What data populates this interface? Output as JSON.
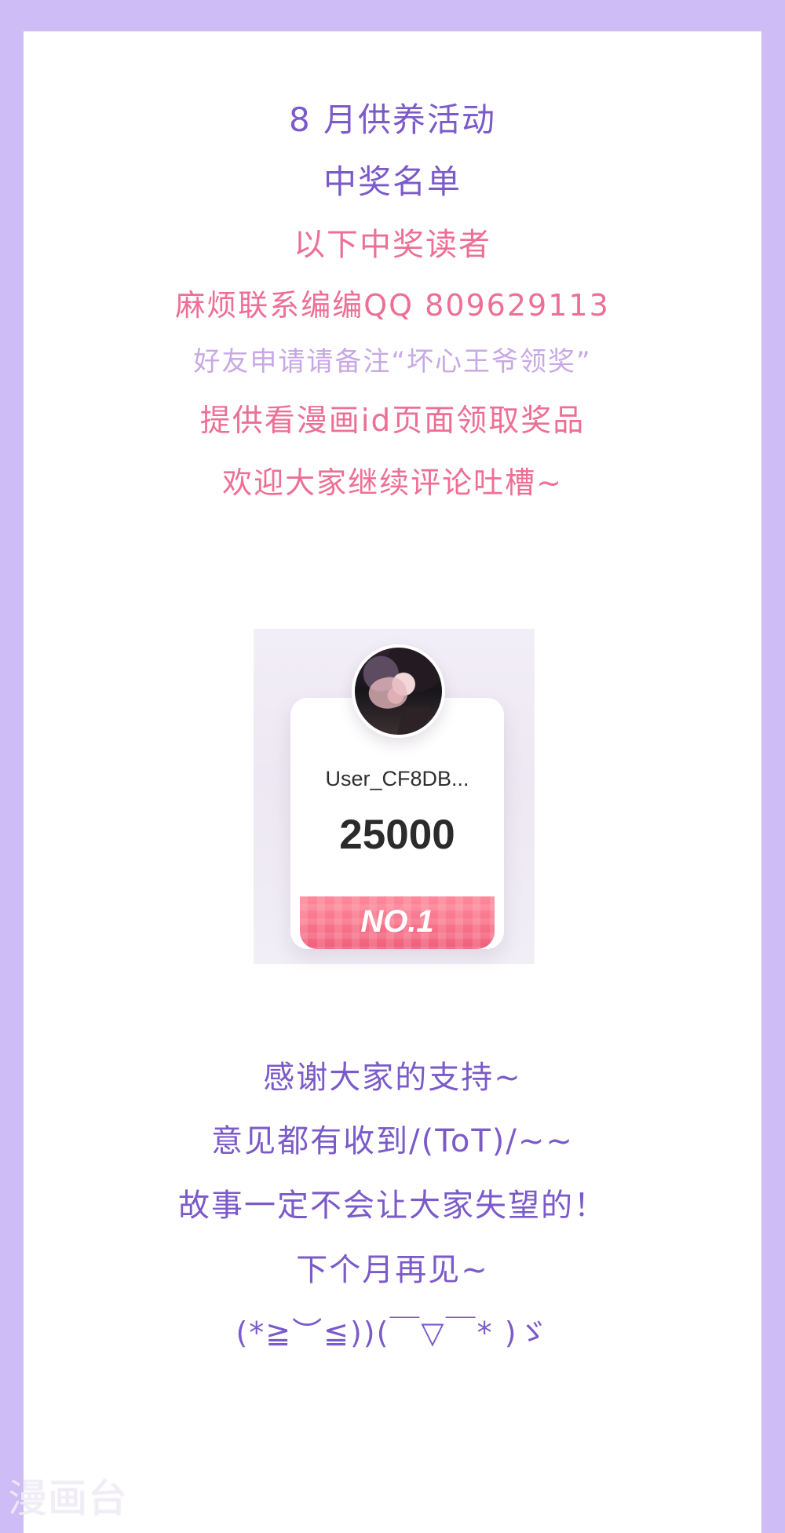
{
  "intro": {
    "line1": "8 月供养活动",
    "line2": "中奖名单",
    "line3": "以下中奖读者",
    "line4": "麻烦联系编编QQ 809629113",
    "line5": "好友申请请备注“坏心王爷领奖”",
    "line6": "提供看漫画id页面领取奖品",
    "line7": "欢迎大家继续评论吐槽~"
  },
  "winner_card": {
    "username": "User_CF8DB...",
    "score": "25000",
    "rank": "NO.1"
  },
  "footer": {
    "line1": "感谢大家的支持~",
    "line2": "意见都有收到/(ToT)/~~",
    "line3": "故事一定不会让大家失望的！",
    "line4": "下个月再见~",
    "line5": "(*≧︶≦))(￣▽￣* )ゞ"
  },
  "watermark": {
    "text": "漫画台"
  },
  "colors": {
    "page_background": "#cdbcf6",
    "panel_background": "#ffffff",
    "purple_text": "#7b5ac9",
    "pink_text": "#ee6f96",
    "lavender_text": "#c8a8e6",
    "rank_band": "#f15f7b"
  }
}
